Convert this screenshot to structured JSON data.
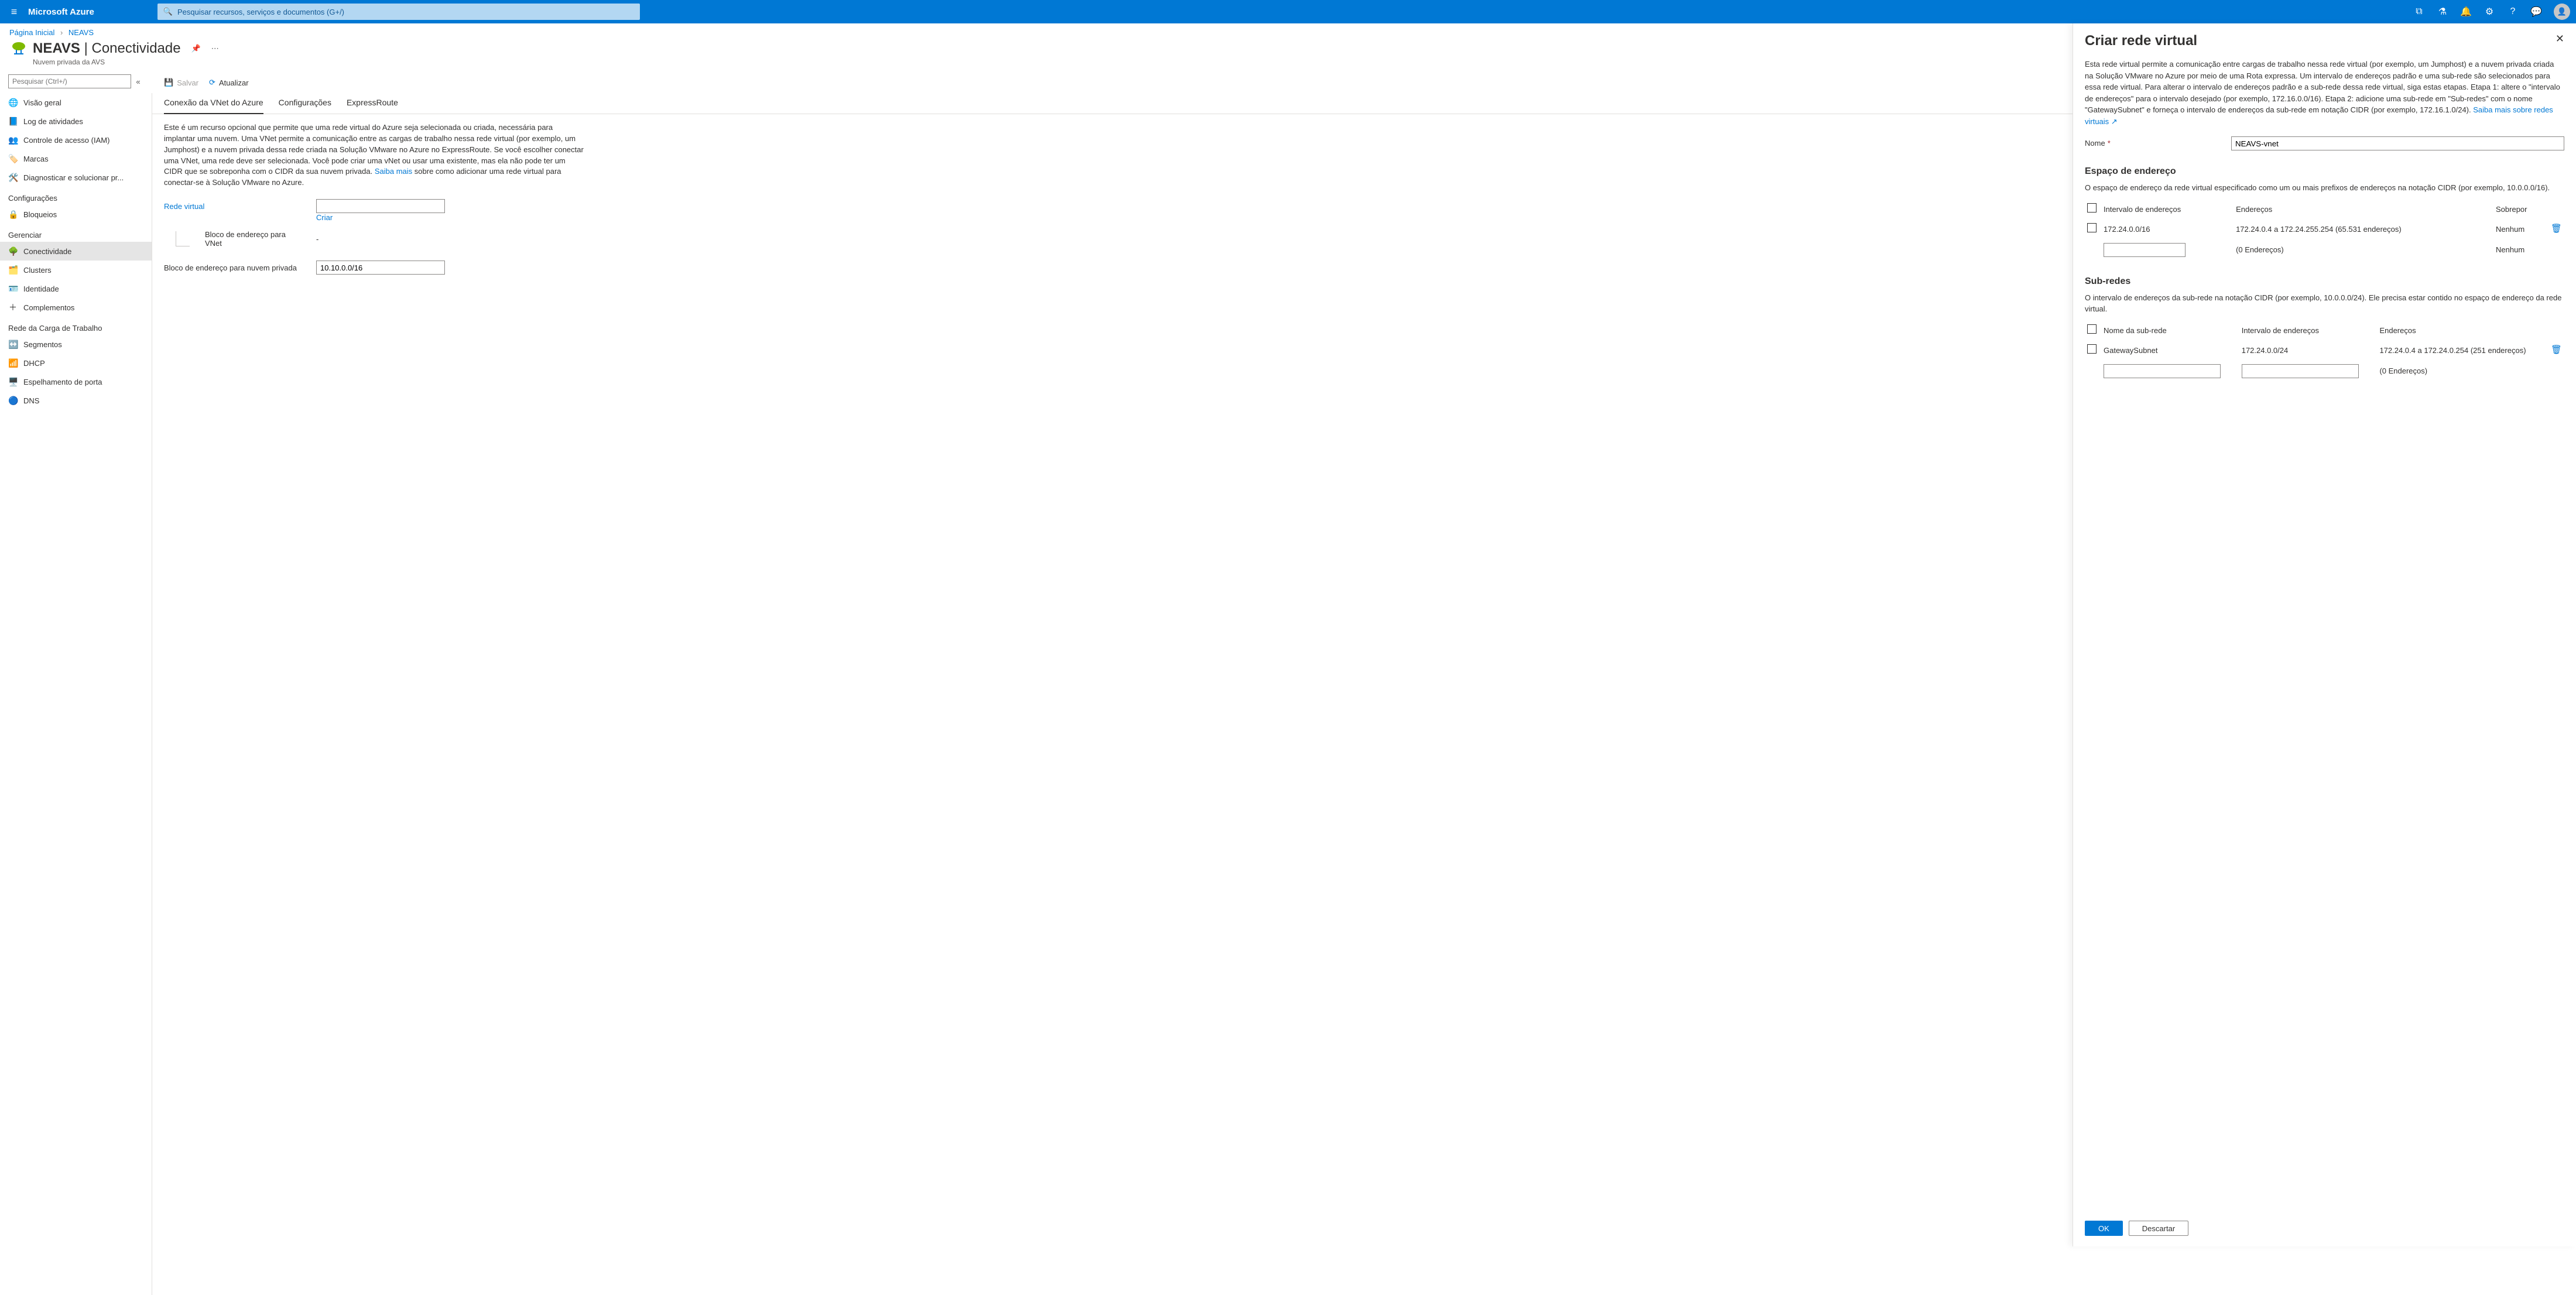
{
  "topbar": {
    "brand": "Microsoft Azure",
    "search_placeholder": "Pesquisar recursos, serviços e documentos (G+/)"
  },
  "breadcrumb": {
    "home": "Página Inicial",
    "current": "NEAVS"
  },
  "page": {
    "title_main": "NEAVS",
    "title_sep": " | ",
    "title_sub": "Conectividade",
    "kind": "Nuvem privada da AVS"
  },
  "leftnav": {
    "filter_placeholder": "Pesquisar (Ctrl+/)",
    "items_top": [
      {
        "icon": "🌐",
        "label": "Visão geral"
      },
      {
        "icon": "📘",
        "label": "Log de atividades"
      },
      {
        "icon": "👥",
        "label": "Controle de acesso (IAM)"
      },
      {
        "icon": "🏷️",
        "label": "Marcas"
      },
      {
        "icon": "🛠️",
        "label": "Diagnosticar e solucionar pr..."
      }
    ],
    "group_cfg": "Configurações",
    "items_cfg": [
      {
        "icon": "🔒",
        "label": "Bloqueios"
      }
    ],
    "group_mng": "Gerenciar",
    "items_mng": [
      {
        "icon": "🌳",
        "label": "Conectividade",
        "selected": true
      },
      {
        "icon": "🗂️",
        "label": "Clusters"
      },
      {
        "icon": "🪪",
        "label": "Identidade"
      },
      {
        "icon": "＋",
        "label": "Complementos"
      }
    ],
    "group_net": "Rede da Carga de Trabalho",
    "items_net": [
      {
        "icon": "↔️",
        "label": "Segmentos"
      },
      {
        "icon": "📶",
        "label": "DHCP"
      },
      {
        "icon": "🖥️",
        "label": "Espelhamento de porta"
      },
      {
        "icon": "🔵",
        "label": "DNS"
      }
    ]
  },
  "toolbar": {
    "save": "Salvar",
    "refresh": "Atualizar"
  },
  "tabs": [
    {
      "label": "Conexão da VNet do Azure",
      "active": true
    },
    {
      "label": "Configurações"
    },
    {
      "label": "ExpressRoute"
    }
  ],
  "main": {
    "paragraph": "Este é um recurso opcional que permite que uma rede virtual do Azure seja selecionada ou criada, necessária para implantar uma nuvem. Uma VNet permite a comunicação entre as cargas de trabalho nessa rede virtual (por exemplo, um Jumphost) e a nuvem privada dessa rede criada na Solução VMware no Azure no ExpressRoute. Se você escolher conectar uma VNet, uma rede deve ser selecionada. Você pode criar uma vNet ou usar uma existente, mas ela não pode ter um CIDR que se sobreponha com o CIDR da sua nuvem privada. ",
    "learn_more": "Saiba mais",
    "learn_more_after": " sobre como adicionar uma rede virtual para conectar-se à Solução VMware no Azure.",
    "vnet_label": "Rede virtual",
    "vnet_create": "Criar",
    "vnet_block_label": "Bloco de endereço para VNet",
    "vnet_block_value": "-",
    "cloud_block_label": "Bloco de endereço para nuvem privada",
    "cloud_block_value": "10.10.0.0/16"
  },
  "flyout": {
    "title": "Criar rede virtual",
    "intro": "Esta rede virtual permite a comunicação entre cargas de trabalho nessa rede virtual (por exemplo, um Jumphost) e a nuvem privada criada na Solução VMware no Azure por meio de uma Rota expressa. Um intervalo de endereços padrão e uma sub-rede são selecionados para essa rede virtual. Para alterar o intervalo de endereços padrão e a sub-rede dessa rede virtual, siga estas etapas. Etapa 1: altere o \"intervalo de endereços\" para o intervalo desejado (por exemplo, 172.16.0.0/16). Etapa 2: adicione uma sub-rede em \"Sub-redes\" com o nome \"GatewaySubnet\" e forneça o intervalo de endereços da sub-rede em notação CIDR (por exemplo, 172.16.1.0/24). ",
    "learn_link": "Saiba mais sobre redes virtuais",
    "name_label": "Nome",
    "name_value": "NEAVS-vnet",
    "addr_header": "Espaço de endereço",
    "addr_desc": "O espaço de endereço da rede virtual especificado como um ou mais prefixos de endereços na notação CIDR (por exemplo, 10.0.0.0/16).",
    "addr_cols": {
      "c1": "Intervalo de endereços",
      "c2": "Endereços",
      "c3": "Sobrepor"
    },
    "addr_rows": [
      {
        "range": "172.24.0.0/16",
        "resolved": "172.24.0.4 a 172.24.255.254 (65.531 endereços)",
        "overlap": "Nenhum",
        "del": true
      },
      {
        "range": "",
        "resolved": "(0 Endereços)",
        "overlap": "Nenhum"
      }
    ],
    "sub_header": "Sub-redes",
    "sub_desc": "O intervalo de endereços da sub-rede na notação CIDR (por exemplo, 10.0.0.0/24). Ele precisa estar contido no espaço de endereço da rede virtual.",
    "sub_cols": {
      "c1": "Nome da sub-rede",
      "c2": "Intervalo de endereços",
      "c3": "Endereços"
    },
    "sub_rows": [
      {
        "name": "GatewaySubnet",
        "range": "172.24.0.0/24",
        "resolved": "172.24.0.4 a 172.24.0.254 (251 endereços)",
        "del": true
      },
      {
        "name": "",
        "range": "",
        "resolved": "(0 Endereços)"
      }
    ],
    "ok": "OK",
    "cancel": "Descartar"
  }
}
